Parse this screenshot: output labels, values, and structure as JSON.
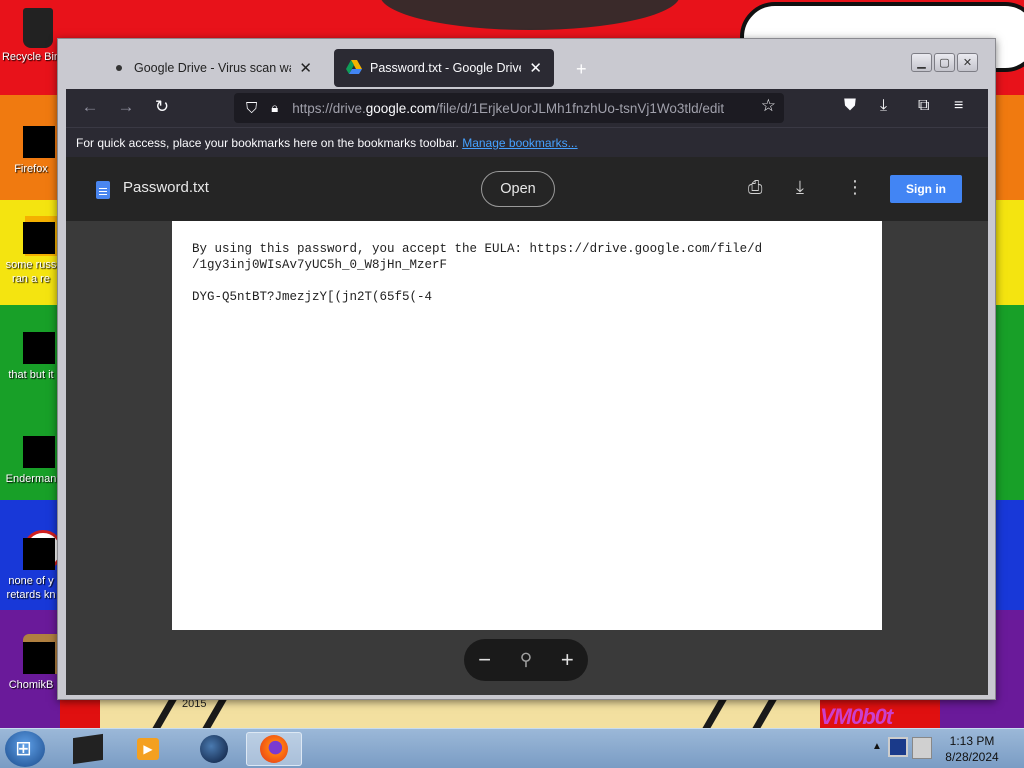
{
  "desktop": {
    "icons": [
      {
        "label": "Recycle Bin",
        "name": "recycle-bin"
      },
      {
        "label": "Firefox",
        "name": "firefox"
      },
      {
        "label": "some russ",
        "label2": "ran a re",
        "name": "shortcut-russ"
      },
      {
        "label": "that but it",
        "name": "shortcut-that"
      },
      {
        "label": "Enderman",
        "name": "enderman"
      },
      {
        "label": "none of y",
        "label2": "retards kn",
        "name": "shortcut-none"
      },
      {
        "label": "ChomikB",
        "name": "chomik"
      }
    ],
    "wallpaper_year": "2015",
    "wallpaper_text": "VM0b0t"
  },
  "browser": {
    "tabs": [
      {
        "title": "Google Drive - Virus scan warning",
        "active": false
      },
      {
        "title": "Password.txt - Google Drive",
        "active": true
      }
    ],
    "url_prefix": "https://drive.",
    "url_domain": "google.com",
    "url_rest": "/file/d/1ErjkeUorJLMh1fnzhUo-tsnVj1Wo3tld/edit",
    "bookmarks_text": "For quick access, place your bookmarks here on the bookmarks toolbar.",
    "bookmarks_link": "Manage bookmarks..."
  },
  "viewer": {
    "file_name": "Password.txt",
    "open_label": "Open",
    "signin_label": "Sign in",
    "lines": [
      "By using this password, you accept the EULA: https://drive.google.com/file/d",
      "/1gy3inj0WIsAv7yUC5h_0_W8jHn_MzerF",
      "",
      "DYG-Q5ntBT?JmezjzY[(jn2T(65f5(-4"
    ]
  },
  "taskbar": {
    "time": "1:13 PM",
    "date": "8/28/2024"
  }
}
